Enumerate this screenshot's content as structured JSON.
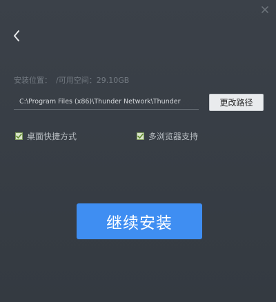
{
  "window": {
    "close_icon": "close-icon",
    "back_icon": "chevron-left-icon"
  },
  "install_path": {
    "location_label": "安装位置：",
    "free_space_label": "/可用空间：",
    "free_space_value": "29.10GB",
    "path_value": "C:\\Program Files (x86)\\Thunder Network\\Thunder",
    "change_button_label": "更改路径"
  },
  "options": [
    {
      "label": "桌面快捷方式",
      "checked": true
    },
    {
      "label": "多浏览器支持",
      "checked": true
    }
  ],
  "install_button_label": "继续安装",
  "colors": {
    "background": "#3b4149",
    "accent": "#3f8ef2",
    "checkbox_check": "#5f8a2c"
  }
}
